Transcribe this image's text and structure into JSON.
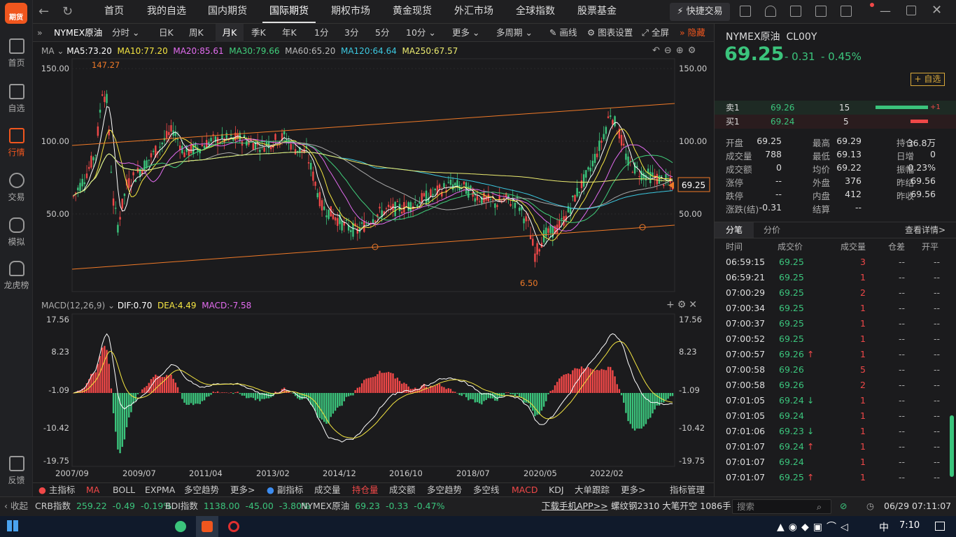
{
  "app": {
    "logo_text": "期货"
  },
  "leftnav": [
    {
      "label": "首页",
      "icon": "grid-icon"
    },
    {
      "label": "自选",
      "icon": "plus-square-icon"
    },
    {
      "label": "行情",
      "icon": "chart-icon",
      "active": true
    },
    {
      "label": "交易",
      "icon": "yen-icon"
    },
    {
      "label": "模拟",
      "icon": "gamepad-icon"
    },
    {
      "label": "龙虎榜",
      "icon": "database-icon"
    },
    {
      "label": "反馈",
      "icon": "feedback-icon"
    }
  ],
  "topnav": [
    "首页",
    "我的自选",
    "国内期货",
    "国际期货",
    "期权市场",
    "黄金现货",
    "外汇市场",
    "全球指数",
    "股票基金"
  ],
  "topnav_active": "国际期货",
  "quick_trade": "快捷交易",
  "toolbar": {
    "symbol": "NYMEX原油",
    "items": [
      "分时",
      "日K",
      "周K",
      "月K",
      "季K",
      "年K",
      "1分",
      "3分",
      "5分",
      "10分",
      "更多",
      "多周期",
      "画线",
      "图表设置",
      "全屏",
      "隐藏"
    ],
    "active": "月K"
  },
  "kline": {
    "ma_legend": {
      "prefix": "MA",
      "ma5": "MA5:73.20",
      "ma10": "MA10:77.20",
      "ma20": "MA20:85.61",
      "ma30": "MA30:79.66",
      "ma60": "MA60:65.20",
      "ma120": "MA120:64.64",
      "ma250": "MA250:67.57"
    },
    "y_labels": [
      "150.00",
      "100.00",
      "50.00"
    ],
    "high_label": "147.27",
    "low_label": "6.50",
    "price_tag": "69.25",
    "colors": {
      "up": "#f04848",
      "down": "#3bc47c",
      "ma5": "#ffffff",
      "ma10": "#f5e642",
      "ma20": "#e36cf0",
      "ma30": "#41d07c",
      "ma60": "#aaaaaa",
      "ma120": "#3cc8e0",
      "ma250": "#ecec70",
      "channel": "#f07a28"
    }
  },
  "macd": {
    "legend": {
      "prefix": "MACD(12,26,9)",
      "dif": "DIF:0.70",
      "dea": "DEA:4.49",
      "macd": "MACD:-7.58"
    },
    "y_labels": [
      "17.56",
      "8.23",
      "-1.09",
      "-10.42",
      "-19.75"
    ],
    "x_labels": [
      "2007/09",
      "2009/07",
      "2011/04",
      "2013/02",
      "2014/12",
      "2016/10",
      "2018/07",
      "2020/05",
      "2022/02"
    ]
  },
  "indicator_bar": {
    "main_label": "主指标",
    "main": [
      "MA",
      "BOLL",
      "EXPMA",
      "多空趋势",
      "更多>"
    ],
    "sub_label": "副指标",
    "sub": [
      "成交量",
      "持仓量",
      "成交额",
      "多空趋势",
      "多空线",
      "MACD",
      "KDJ",
      "大单跟踪",
      "更多>"
    ],
    "manage": "指标管理"
  },
  "quote": {
    "name": "NYMEX原油",
    "code": "CL00Y",
    "price": "69.25",
    "change": "- 0.31",
    "pct": "- 0.45%",
    "watch_btn": "自选",
    "sell1": {
      "label": "卖1",
      "price": "69.26",
      "vol": "15",
      "delta": "+1"
    },
    "buy1": {
      "label": "买1",
      "price": "69.24",
      "vol": "5"
    },
    "stats": [
      [
        "开盘",
        "69.25",
        "最高",
        "69.29",
        "持仓",
        "36.8万"
      ],
      [
        "成交量",
        "788",
        "最低",
        "69.13",
        "日增",
        "0"
      ],
      [
        "成交额",
        "0",
        "均价",
        "69.22",
        "振幅",
        "0.23%"
      ],
      [
        "涨停",
        "--",
        "外盘",
        "376",
        "昨结",
        "69.56"
      ],
      [
        "跌停",
        "--",
        "内盘",
        "412",
        "昨收",
        "69.56"
      ],
      [
        "涨跌(结)",
        "-0.31",
        "结算",
        "--",
        "",
        ""
      ]
    ],
    "tabs": [
      "分笔",
      "分价"
    ],
    "detail_link": "查看详情>",
    "tick_headers": [
      "时间",
      "成交价",
      "成交量",
      "仓差",
      "开平"
    ],
    "ticks": [
      [
        "06:59:15",
        "69.25",
        "3",
        "--",
        "--",
        ""
      ],
      [
        "06:59:21",
        "69.25",
        "1",
        "--",
        "--",
        ""
      ],
      [
        "07:00:29",
        "69.25",
        "2",
        "--",
        "--",
        ""
      ],
      [
        "07:00:34",
        "69.25",
        "1",
        "--",
        "--",
        ""
      ],
      [
        "07:00:37",
        "69.25",
        "1",
        "--",
        "--",
        ""
      ],
      [
        "07:00:52",
        "69.25",
        "1",
        "--",
        "--",
        ""
      ],
      [
        "07:00:57",
        "69.26",
        "1",
        "--",
        "--",
        "up"
      ],
      [
        "07:00:58",
        "69.26",
        "5",
        "--",
        "--",
        ""
      ],
      [
        "07:00:58",
        "69.26",
        "2",
        "--",
        "--",
        ""
      ],
      [
        "07:01:05",
        "69.24",
        "1",
        "--",
        "--",
        "down"
      ],
      [
        "07:01:05",
        "69.24",
        "1",
        "--",
        "--",
        ""
      ],
      [
        "07:01:06",
        "69.23",
        "1",
        "--",
        "--",
        "down"
      ],
      [
        "07:01:07",
        "69.24",
        "1",
        "--",
        "--",
        "up"
      ],
      [
        "07:01:07",
        "69.24",
        "1",
        "--",
        "--",
        ""
      ],
      [
        "07:01:07",
        "69.25",
        "1",
        "--",
        "--",
        "up"
      ]
    ]
  },
  "status": {
    "collapse": "收起",
    "items": [
      {
        "name": "CRB指数",
        "val": "259.22",
        "chg": "-0.49",
        "pct": "-0.19%"
      },
      {
        "name": "BDI指数",
        "val": "1138.00",
        "chg": "-45.00",
        "pct": "-3.80%"
      },
      {
        "name": "NYMEX原油",
        "val": "69.23",
        "chg": "-0.33",
        "pct": "-0.47%"
      }
    ],
    "download": "下载手机APP>>",
    "news": "螺纹钢2310 大笔开空 1086手",
    "search_placeholder": "搜索",
    "datetime": "06/29 07:11:07"
  },
  "taskbar": {
    "ime": "中",
    "time": "7:10"
  }
}
